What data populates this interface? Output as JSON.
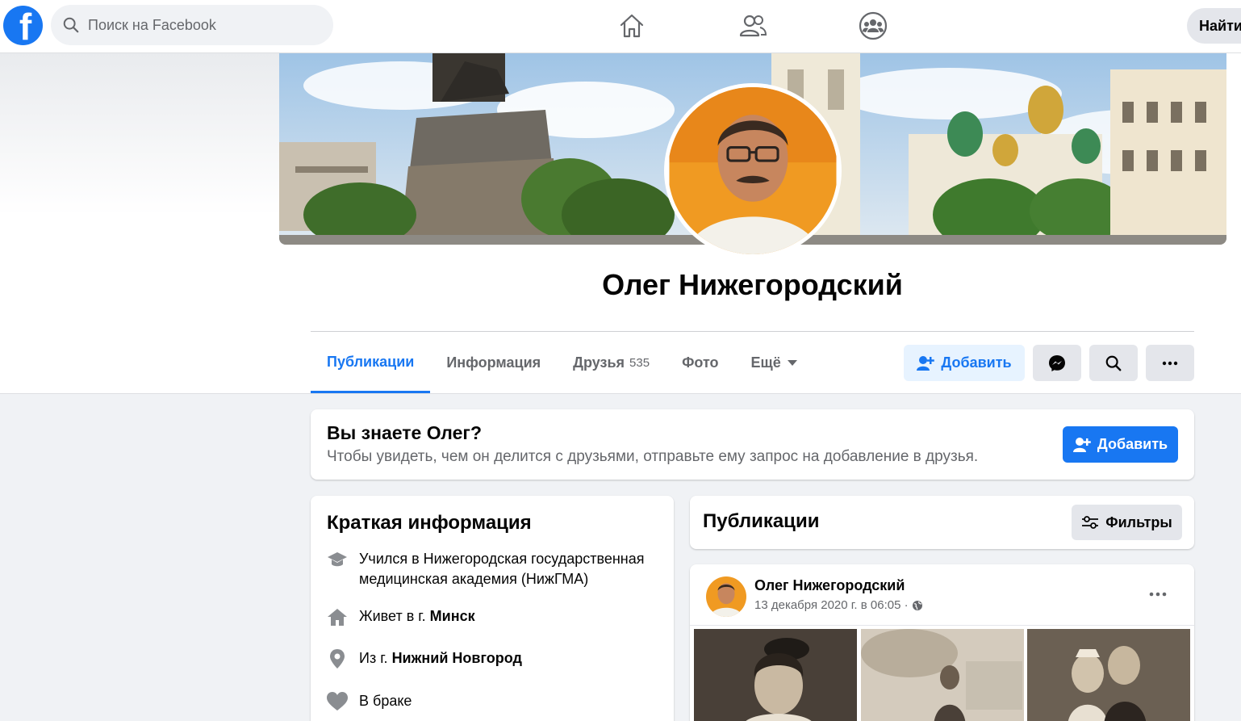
{
  "topbar": {
    "logo": "facebook-logo",
    "search_placeholder": "Поиск на Facebook",
    "nav_icons": [
      "home-icon",
      "friends-icon",
      "groups-icon"
    ],
    "find_label": "Найти"
  },
  "profile": {
    "name": "Олег Нижегородский"
  },
  "tabs": [
    {
      "label": "Публикации",
      "active": true
    },
    {
      "label": "Информация"
    },
    {
      "label": "Друзья",
      "count": "535"
    },
    {
      "label": "Фото"
    },
    {
      "label": "Ещё"
    }
  ],
  "actions": {
    "add_label": "Добавить"
  },
  "know_card": {
    "title": "Вы знаете Олег?",
    "subtitle": "Чтобы увидеть, чем он делится с друзьями, отправьте ему запрос на добавление в друзья.",
    "button_label": "Добавить"
  },
  "intro": {
    "title": "Краткая информация",
    "items": [
      {
        "icon": "graduation-cap-icon",
        "line1": "Учился в Нижегородская государственная",
        "line2": "медицинская академия (НижГМА)"
      },
      {
        "icon": "house-icon",
        "prefix": "Живет в г. ",
        "bold": "Минск"
      },
      {
        "icon": "location-pin-icon",
        "prefix": "Из г. ",
        "bold": "Нижний Новгород"
      },
      {
        "icon": "heart-icon",
        "text": "В браке"
      }
    ]
  },
  "publications": {
    "title": "Публикации",
    "filters_label": "Фильтры"
  },
  "post": {
    "author": "Олег Нижегородский",
    "date": "13 декабря 2020 г. в 06:05 ·",
    "privacy_icon": "globe-icon"
  },
  "colors": {
    "accent": "#1877f2",
    "light_accent": "#e7f3ff",
    "bg": "#f0f2f5"
  }
}
